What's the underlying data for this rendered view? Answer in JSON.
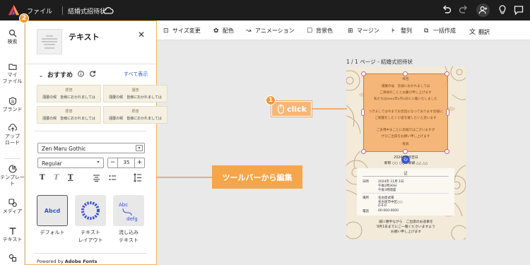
{
  "topbar": {
    "menu_file": "ファイル",
    "doc_title": "結婚式招待状"
  },
  "rail": {
    "items": [
      {
        "icon": "search-icon",
        "label": "検索"
      },
      {
        "icon": "folder-icon",
        "label": "マイ\nファイル"
      },
      {
        "icon": "brand-icon",
        "label": "ブランド"
      },
      {
        "icon": "upload-icon",
        "label": "アップ\nロード"
      },
      {
        "icon": "template-icon",
        "label": "テンプレート"
      },
      {
        "icon": "media-icon",
        "label": "メディア"
      },
      {
        "icon": "text-icon",
        "label": "テキスト"
      },
      {
        "icon": "elements-icon",
        "label": ""
      }
    ]
  },
  "panel": {
    "badge": "2",
    "title": "テキスト",
    "recommend_label": "おすすめ",
    "show_all": "すべて表示",
    "cards": [
      {
        "top": "拝啓",
        "bottom": "謹慶の候　皆様におかれましては"
      },
      {
        "top": "謹啓",
        "bottom": "謹慶の候　皆様におかれましては"
      },
      {
        "top": "拝啓",
        "bottom": "謹慶の候　皆様におかれましては"
      },
      {
        "top": "拝啓",
        "bottom": "謹慶の候　皆様におかれましては"
      }
    ],
    "font_family": "Zen Maru Gothic",
    "font_weight": "Regular",
    "font_size": "35",
    "presets": [
      {
        "label": "デフォルト",
        "sample": "Abcd"
      },
      {
        "label": "テキスト\nレイアウト",
        "sample": "ABCDEFGH"
      },
      {
        "label": "流し込み\nテキスト",
        "sample": "Abc defg"
      }
    ],
    "powered_prefix": "Powered by ",
    "powered_brand": "Adobe Fonts"
  },
  "toolbar": {
    "items": [
      {
        "icon": "resize-icon",
        "label": "サイズ変更"
      },
      {
        "icon": "palette-icon",
        "label": "配色"
      },
      {
        "icon": "animation-icon",
        "label": "アニメーション"
      },
      {
        "icon": "background-icon",
        "label": "背景色"
      },
      {
        "icon": "margin-icon",
        "label": "マージン"
      },
      {
        "icon": "align-icon",
        "label": "整列"
      },
      {
        "icon": "batch-icon",
        "label": "一括作成"
      },
      {
        "icon": "translate-icon",
        "label": "翻訳"
      }
    ]
  },
  "canvas": {
    "page_label": "1 / 1 ページ - 結婚式招待状",
    "selected_lines": [
      "拝啓",
      "謹慶の候　皆様におかれましては",
      "ご清祥のこととお慶び申し上げます",
      "私たちはxxxx年x月x日に入籍いたしました",
      "",
      "つきましては今までお世話になっております皆様に",
      "ご披露をしたく小宴を催したいと思います",
      "",
      "ご多用中まことに恐縮ではございますが",
      "ぜひご出席をお願い申し上げます",
      "敬具"
    ],
    "date_line": "2024年4月吉日",
    "names_line": "新郎 ○○ ○○　新婦 △△ △△",
    "info_title": "記",
    "info_rows": [
      {
        "k": "日時",
        "v": "2024年 11月 1日"
      },
      {
        "k": "",
        "v": "午後2時30分"
      },
      {
        "k": "",
        "v": "午後3時開宴"
      },
      {
        "k": "場所",
        "v": "名古屋式場"
      },
      {
        "k": "",
        "v": "名古屋市中区○○"
      },
      {
        "k": "",
        "v": "0-0-0"
      },
      {
        "k": "電話",
        "v": "00-000-0000"
      }
    ],
    "closing_lines": [
      "誠に勝手ながら　ご出席のお返事を",
      "9月1日までにご一報くださいますよう",
      "お願い申し上げます"
    ]
  },
  "annotations": {
    "click_badge": "1",
    "click_label": "click",
    "callout": "ツールバーから編集"
  },
  "colors": {
    "accent": "#f29a2e",
    "selection": "#f5ac64",
    "link": "#2f5bd3",
    "topbar": "#1d1d1d"
  }
}
